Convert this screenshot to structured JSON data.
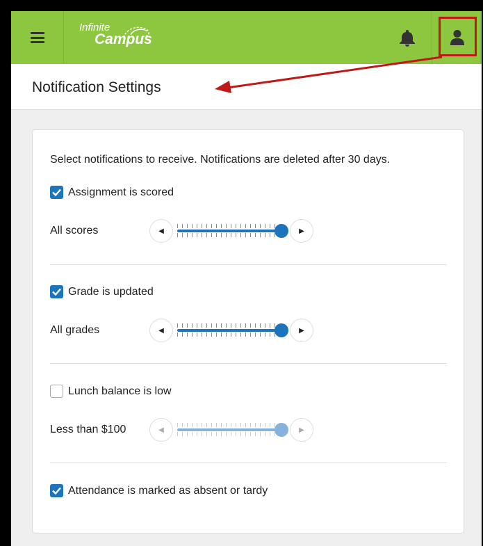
{
  "brand": {
    "line1": "Infinite",
    "line2": "Campus"
  },
  "page_title": "Notification Settings",
  "intro": "Select notifications to receive. Notifications are deleted after 30 days.",
  "settings": [
    {
      "label": "Assignment is scored",
      "checked": true,
      "slider_label": "All scores",
      "level": 1.0,
      "enabled": true
    },
    {
      "label": "Grade is updated",
      "checked": true,
      "slider_label": "All grades",
      "level": 1.0,
      "enabled": true
    },
    {
      "label": "Lunch balance is low",
      "checked": false,
      "slider_label": "Less than $100",
      "level": 1.0,
      "enabled": false
    },
    {
      "label": "Attendance is marked as absent or tardy",
      "checked": true
    }
  ],
  "icons": {
    "menu": "hamburger-menu-icon",
    "notifications": "bell-icon",
    "user": "user-icon",
    "decrease": "triangle-left-icon",
    "increase": "triangle-right-icon",
    "check": "checkmark-icon"
  },
  "colors": {
    "topbar": "#8dc63f",
    "accent": "#1c75bc",
    "highlight": "#c01818"
  }
}
